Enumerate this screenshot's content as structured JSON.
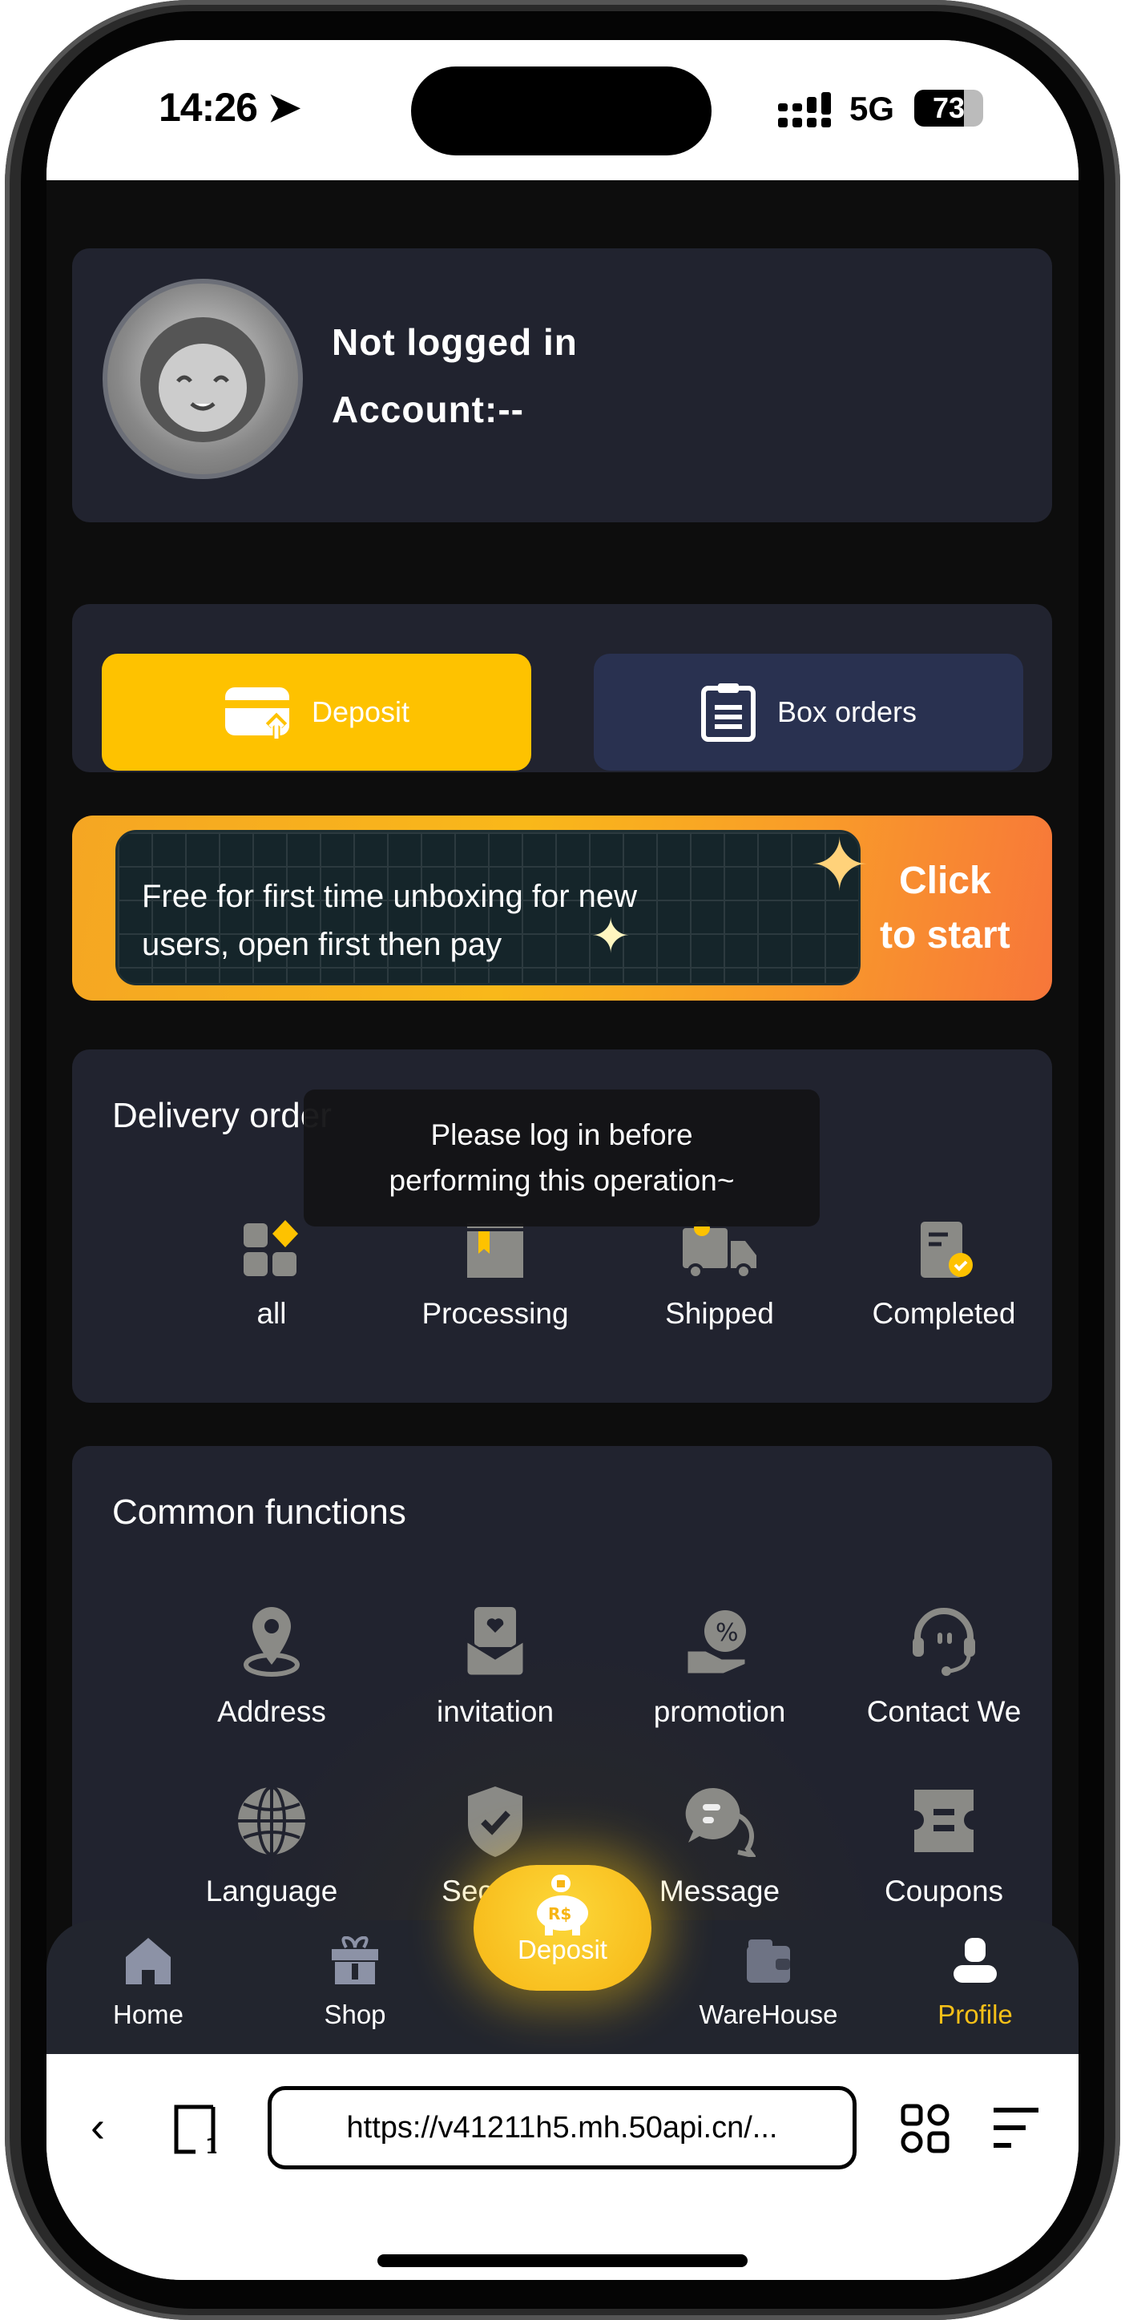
{
  "status_bar": {
    "time": "14:26",
    "network": "5G",
    "battery": "73"
  },
  "profile": {
    "status": "Not logged in",
    "account": "Account:--"
  },
  "actions": {
    "deposit": "Deposit",
    "box_orders": "Box orders"
  },
  "banner": {
    "text_line1": "Free for first time unboxing for new",
    "text_line2": "users, open first then pay",
    "cta_line1": "Click",
    "cta_line2": "to start"
  },
  "delivery": {
    "title": "Delivery order",
    "items": [
      {
        "label": "all"
      },
      {
        "label": "Processing"
      },
      {
        "label": "Shipped"
      },
      {
        "label": "Completed"
      }
    ]
  },
  "toast": {
    "line1": "Please log in before",
    "line2": "performing this operation~"
  },
  "common": {
    "title": "Common functions",
    "items": [
      {
        "label": "Address"
      },
      {
        "label": "invitation"
      },
      {
        "label": "promotion"
      },
      {
        "label": "Contact We"
      },
      {
        "label": "Language"
      },
      {
        "label": "Security"
      },
      {
        "label": "Message"
      },
      {
        "label": "Coupons"
      }
    ]
  },
  "nav": {
    "items": [
      {
        "label": "Home"
      },
      {
        "label": "Shop"
      },
      {
        "label": "Deposit",
        "badge": "R$"
      },
      {
        "label": "WareHouse"
      },
      {
        "label": "Profile",
        "active": true
      }
    ]
  },
  "browser": {
    "url": "https://v41211h5.mh.50api.cn/..."
  },
  "colors": {
    "accent": "#fec200",
    "card": "#21232f",
    "icon": "#8a8a86",
    "active_nav": "#f5c018"
  }
}
